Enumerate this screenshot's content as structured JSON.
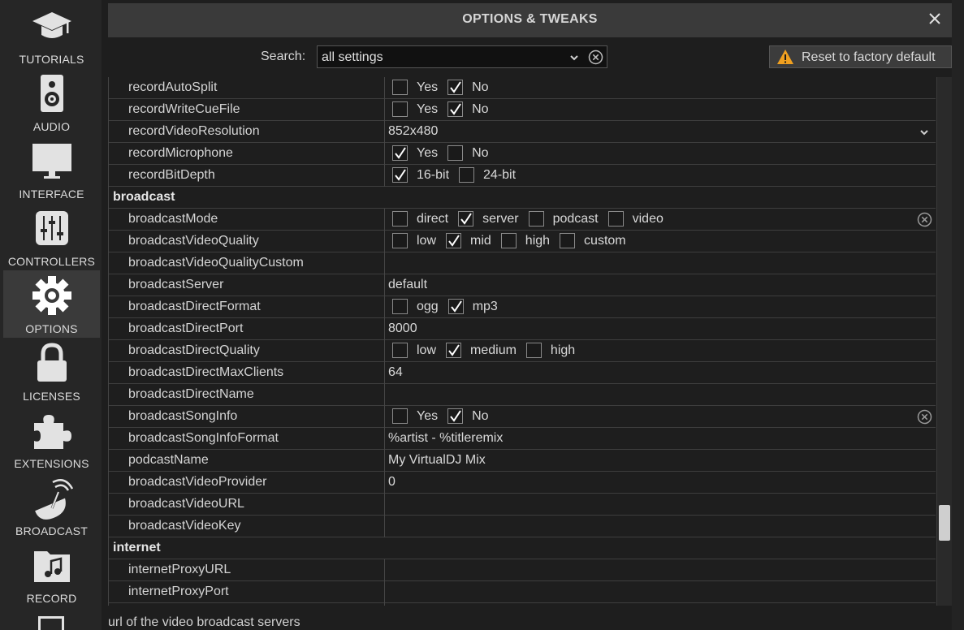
{
  "sidebar": {
    "items": [
      {
        "label": "TUTORIALS",
        "icon": "graduation-cap-icon"
      },
      {
        "label": "AUDIO",
        "icon": "speaker-icon"
      },
      {
        "label": "INTERFACE",
        "icon": "monitor-icon"
      },
      {
        "label": "CONTROLLERS",
        "icon": "mixer-sliders-icon"
      },
      {
        "label": "OPTIONS",
        "icon": "gear-icon",
        "active": true
      },
      {
        "label": "LICENSES",
        "icon": "lock-icon"
      },
      {
        "label": "EXTENSIONS",
        "icon": "puzzle-icon"
      },
      {
        "label": "BROADCAST",
        "icon": "satellite-dish-icon"
      },
      {
        "label": "RECORD",
        "icon": "music-folder-icon"
      }
    ]
  },
  "header": {
    "title": "OPTIONS & TWEAKS"
  },
  "search": {
    "label": "Search:",
    "value": "all settings"
  },
  "reset": {
    "label": "Reset to factory default"
  },
  "rows": [
    {
      "name": "recordAutoSplit",
      "options": [
        {
          "label": "Yes",
          "checked": false
        },
        {
          "label": "No",
          "checked": true
        }
      ]
    },
    {
      "name": "recordWriteCueFile",
      "options": [
        {
          "label": "Yes",
          "checked": false
        },
        {
          "label": "No",
          "checked": true
        }
      ]
    },
    {
      "name": "recordVideoResolution",
      "value": "852x480"
    },
    {
      "name": "recordMicrophone",
      "options": [
        {
          "label": "Yes",
          "checked": true
        },
        {
          "label": "No",
          "checked": false
        }
      ]
    },
    {
      "name": "recordBitDepth",
      "options": [
        {
          "label": "16-bit",
          "checked": true
        },
        {
          "label": "24-bit",
          "checked": false
        }
      ]
    },
    {
      "name": "broadcast"
    },
    {
      "name": "broadcastMode",
      "options": [
        {
          "label": "direct",
          "checked": false
        },
        {
          "label": "server",
          "checked": true
        },
        {
          "label": "podcast",
          "checked": false
        },
        {
          "label": "video",
          "checked": false
        }
      ]
    },
    {
      "name": "broadcastVideoQuality",
      "options": [
        {
          "label": "low",
          "checked": false
        },
        {
          "label": "mid",
          "checked": true
        },
        {
          "label": "high",
          "checked": false
        },
        {
          "label": "custom",
          "checked": false
        }
      ]
    },
    {
      "name": "broadcastVideoQualityCustom",
      "value": ""
    },
    {
      "name": "broadcastServer",
      "value": "default"
    },
    {
      "name": "broadcastDirectFormat",
      "options": [
        {
          "label": "ogg",
          "checked": false
        },
        {
          "label": "mp3",
          "checked": true
        }
      ]
    },
    {
      "name": "broadcastDirectPort",
      "value": "8000"
    },
    {
      "name": "broadcastDirectQuality",
      "options": [
        {
          "label": "low",
          "checked": false
        },
        {
          "label": "medium",
          "checked": true
        },
        {
          "label": "high",
          "checked": false
        }
      ]
    },
    {
      "name": "broadcastDirectMaxClients",
      "value": "64"
    },
    {
      "name": "broadcastDirectName",
      "value": ""
    },
    {
      "name": "broadcastSongInfo",
      "options": [
        {
          "label": "Yes",
          "checked": false
        },
        {
          "label": "No",
          "checked": true
        }
      ]
    },
    {
      "name": "broadcastSongInfoFormat",
      "value": "%artist - %titleremix"
    },
    {
      "name": "podcastName",
      "value": "My VirtualDJ Mix"
    },
    {
      "name": "broadcastVideoProvider",
      "value": "0"
    },
    {
      "name": "broadcastVideoURL",
      "value": ""
    },
    {
      "name": "broadcastVideoKey",
      "value": ""
    },
    {
      "name": "internet"
    },
    {
      "name": "internetProxyURL",
      "value": ""
    },
    {
      "name": "internetProxyPort",
      "value": ""
    }
  ],
  "hint": "url of the video broadcast servers",
  "colors": {
    "background": "#1e1e1e",
    "sidebar": "#262626",
    "active": "#3a3a3a",
    "warning": "#f0a020"
  }
}
